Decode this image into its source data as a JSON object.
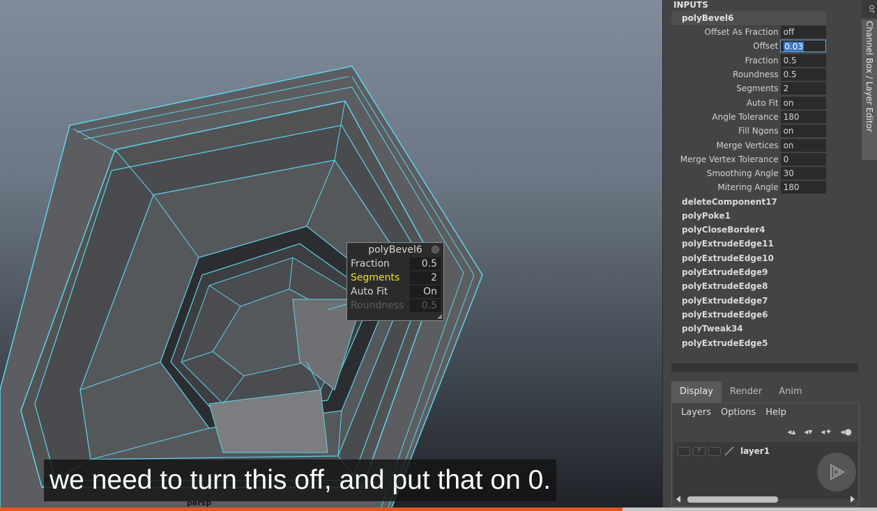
{
  "viewport": {
    "camera_label": "persp",
    "wire_color": "#5fd4ef"
  },
  "in_view_editor": {
    "title": "polyBevel6",
    "rows": [
      {
        "label": "Fraction",
        "value": "0.5",
        "state": "normal"
      },
      {
        "label": "Segments",
        "value": "2",
        "state": "active"
      },
      {
        "label": "Auto Fit",
        "value": "On",
        "state": "normal"
      },
      {
        "label": "Roundness",
        "value": "0.5",
        "state": "disabled"
      }
    ]
  },
  "subtitle": "we need to turn this off, and put that on 0.",
  "progress": {
    "fraction": 0.71,
    "color": "#e4581c"
  },
  "channel_box": {
    "inputs_label": "INPUTS",
    "node": "polyBevel6",
    "attributes": [
      {
        "name": "Offset As Fraction",
        "value": "off"
      },
      {
        "name": "Offset",
        "value": "0.03",
        "editing": true
      },
      {
        "name": "Fraction",
        "value": "0.5"
      },
      {
        "name": "Roundness",
        "value": "0.5"
      },
      {
        "name": "Segments",
        "value": "2"
      },
      {
        "name": "Auto Fit",
        "value": "on"
      },
      {
        "name": "Angle Tolerance",
        "value": "180"
      },
      {
        "name": "Fill Ngons",
        "value": "on"
      },
      {
        "name": "Merge Vertices",
        "value": "on"
      },
      {
        "name": "Merge Vertex Tolerance",
        "value": "0"
      },
      {
        "name": "Smoothing Angle",
        "value": "30"
      },
      {
        "name": "Mitering Angle",
        "value": "180"
      }
    ],
    "history": [
      "deleteComponent17",
      "polyPoke1",
      "polyCloseBorder4",
      "polyExtrudeEdge11",
      "polyExtrudeEdge10",
      "polyExtrudeEdge9",
      "polyExtrudeEdge8",
      "polyExtrudeEdge7",
      "polyExtrudeEdge6",
      "polyTweak34",
      "polyExtrudeEdge5"
    ]
  },
  "side_tabs": {
    "active": "Channel Box / Layer Editor",
    "top_fragment": "or"
  },
  "layer_editor": {
    "tabs": [
      {
        "label": "Display",
        "active": true
      },
      {
        "label": "Render",
        "active": false
      },
      {
        "label": "Anim",
        "active": false
      }
    ],
    "menus": [
      "Layers",
      "Options",
      "Help"
    ],
    "layer_flag": "P",
    "layers": [
      {
        "name": "layer1"
      }
    ]
  }
}
